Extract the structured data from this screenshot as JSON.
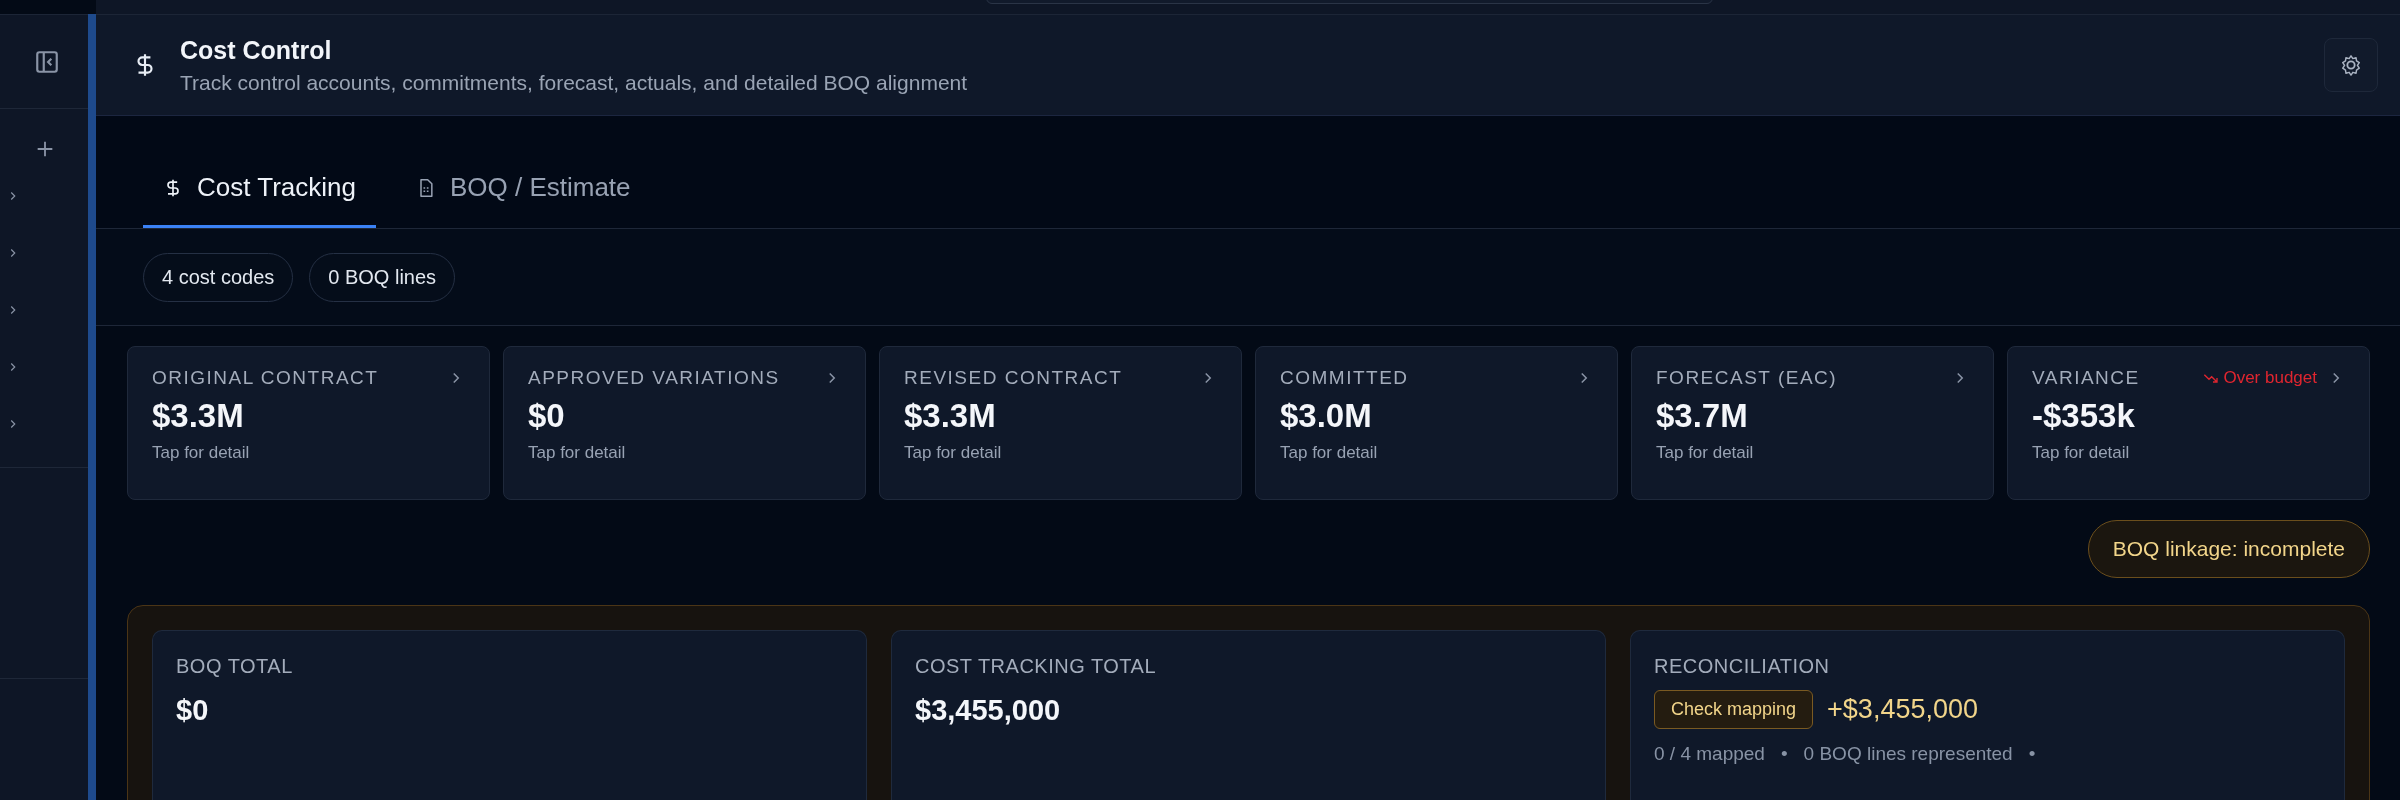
{
  "header": {
    "title": "Cost Control",
    "subtitle": "Track control accounts, commitments, forecast, actuals, and detailed BOQ alignment"
  },
  "tabs": [
    {
      "label": "Cost Tracking",
      "kind": "dollar",
      "selected": true
    },
    {
      "label": "BOQ / Estimate",
      "kind": "document",
      "selected": false
    }
  ],
  "chips": [
    "4 cost codes",
    "0 BOQ lines"
  ],
  "kpis": [
    {
      "label": "ORIGINAL CONTRACT",
      "value": "$3.3M",
      "note": "Tap for detail"
    },
    {
      "label": "APPROVED VARIATIONS",
      "value": "$0",
      "note": "Tap for detail"
    },
    {
      "label": "REVISED CONTRACT",
      "value": "$3.3M",
      "note": "Tap for detail"
    },
    {
      "label": "COMMITTED",
      "value": "$3.0M",
      "note": "Tap for detail"
    },
    {
      "label": "FORECAST (EAC)",
      "value": "$3.7M",
      "note": "Tap for detail"
    },
    {
      "label": "VARIANCE",
      "value": "-$353k",
      "note": "Tap for detail",
      "status": {
        "text": "Over budget",
        "kind": "over"
      }
    }
  ],
  "linkage_badge": "BOQ linkage: incomplete",
  "reconciliation_panel": {
    "columns": [
      {
        "label": "BOQ TOTAL",
        "value": "$0"
      },
      {
        "label": "COST TRACKING TOTAL",
        "value": "$3,455,000"
      },
      {
        "label": "RECONCILIATION",
        "tag": "Check mapping",
        "value": "+$3,455,000",
        "stats": [
          "0 / 4 mapped",
          "0 BOQ lines represented"
        ],
        "separator": "•"
      }
    ]
  }
}
